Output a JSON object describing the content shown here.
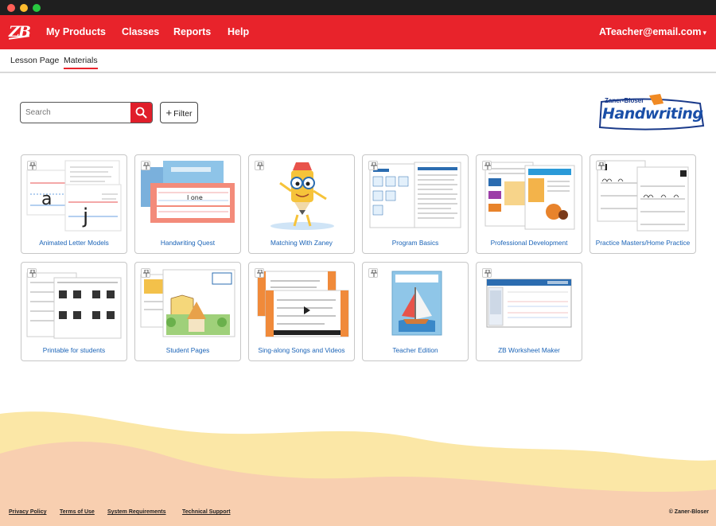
{
  "nav": {
    "logo": "ZB",
    "links": [
      "My Products",
      "Classes",
      "Reports",
      "Help"
    ],
    "user": "ATeacher@email.com"
  },
  "subnav": {
    "tabs": [
      "Lesson Page",
      "Materials"
    ],
    "active": "Materials"
  },
  "search": {
    "placeholder": "Search",
    "value": ""
  },
  "filter": {
    "label": "Filter"
  },
  "brand": {
    "top": "Zaner-Bloser",
    "main": "Handwriting"
  },
  "materials": [
    {
      "label": "Animated Letter Models",
      "icon": "letter-models-thumbnail"
    },
    {
      "label": "Handwriting Quest",
      "icon": "quest-thumbnail"
    },
    {
      "label": "Matching With Zaney",
      "icon": "zaney-pencil-thumbnail"
    },
    {
      "label": "Program Basics",
      "icon": "program-basics-thumbnail"
    },
    {
      "label": "Professional Development",
      "icon": "professional-development-thumbnail"
    },
    {
      "label": "Practice Masters/Home Practice",
      "icon": "practice-masters-thumbnail"
    },
    {
      "label": "Printable for students",
      "icon": "printables-thumbnail"
    },
    {
      "label": "Student Pages",
      "icon": "student-pages-thumbnail"
    },
    {
      "label": "Sing-along Songs and Videos",
      "icon": "songs-videos-thumbnail"
    },
    {
      "label": "Teacher Edition",
      "icon": "teacher-edition-thumbnail"
    },
    {
      "label": "ZB Worksheet Maker",
      "icon": "worksheet-maker-thumbnail"
    }
  ],
  "thumb_text": {
    "quest_line": "I one"
  },
  "footer": {
    "links": [
      "Privacy Policy",
      "Terms of Use",
      "System Requirements",
      "Technical Support"
    ],
    "copyright": "© Zaner-Bloser"
  },
  "colors": {
    "brand_red": "#e8232b",
    "link_blue": "#1a63b7",
    "wave_yellow": "#fbe7a6",
    "wave_peach": "#f8cfb0"
  }
}
